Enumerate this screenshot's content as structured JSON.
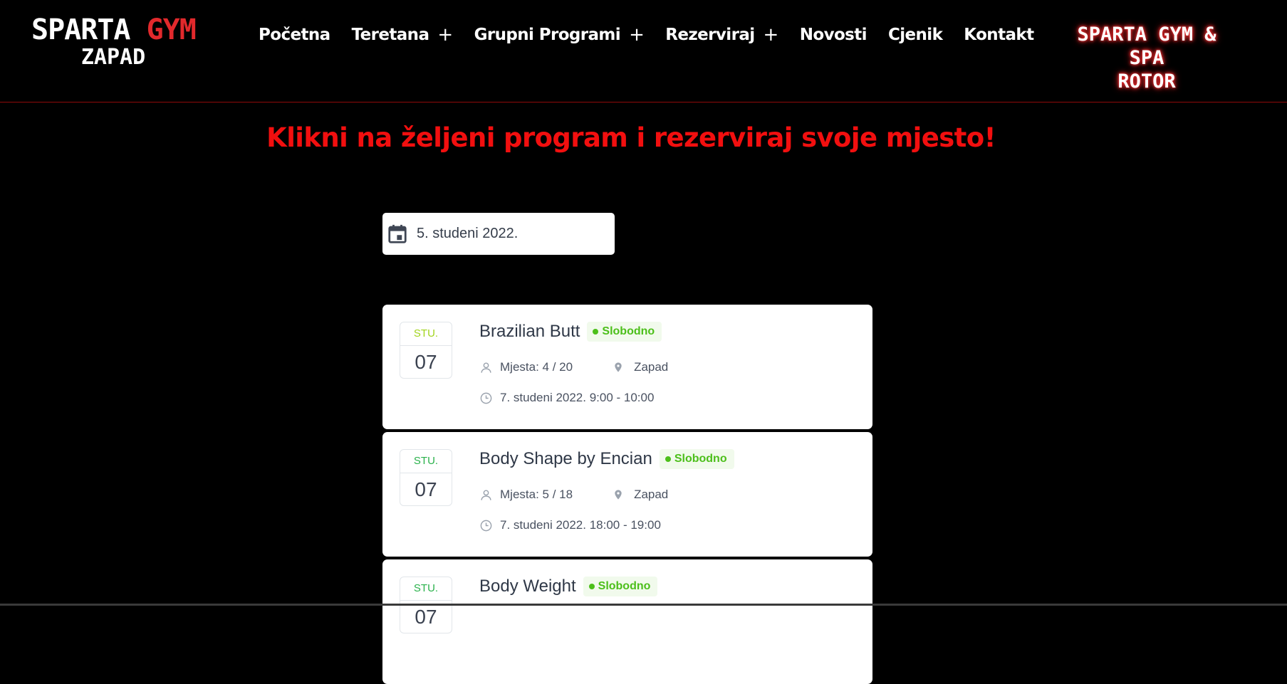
{
  "header": {
    "logo": {
      "line1_a": "SPARTA ",
      "line1_b": "GYM",
      "line2": "ZAPAD"
    },
    "nav": [
      {
        "label": "Početna",
        "has_submenu": false
      },
      {
        "label": "Teretana",
        "has_submenu": true
      },
      {
        "label": "Grupni Programi",
        "has_submenu": true
      },
      {
        "label": "Rezerviraj",
        "has_submenu": true
      },
      {
        "label": "Novosti",
        "has_submenu": false
      },
      {
        "label": "Cjenik",
        "has_submenu": false
      },
      {
        "label": "Kontakt",
        "has_submenu": false
      }
    ],
    "submenu_symbol": "+",
    "right_logo": {
      "line1": "SPARTA GYM & SPA",
      "line2": "ROTOR"
    }
  },
  "headline": "Klikni na željeni program i rezerviraj svoje mjesto!",
  "date_picker": {
    "value": "5. studeni 2022.",
    "icon": "calendar-icon"
  },
  "events": [
    {
      "month": "STU.",
      "day": "07",
      "month_color": "#a2d41e",
      "title": "Brazilian Butt",
      "status": "Slobodno",
      "spots": "Mjesta: 4 / 20",
      "location": "Zapad",
      "time": "7. studeni 2022. 9:00 - 10:00"
    },
    {
      "month": "STU.",
      "day": "07",
      "month_color": "#2bb24c",
      "title": "Body Shape by Encian",
      "status": "Slobodno",
      "spots": "Mjesta: 5 / 18",
      "location": "Zapad",
      "time": "7. studeni 2022. 18:00 - 19:00"
    },
    {
      "month": "STU.",
      "day": "07",
      "month_color": "#2bb24c",
      "title": "Body Weight",
      "status": "Slobodno",
      "spots": "",
      "location": "",
      "time": ""
    }
  ],
  "colors": {
    "brand_red": "#f20f0f",
    "status_green": "#4cbf1a",
    "background": "#000000"
  }
}
